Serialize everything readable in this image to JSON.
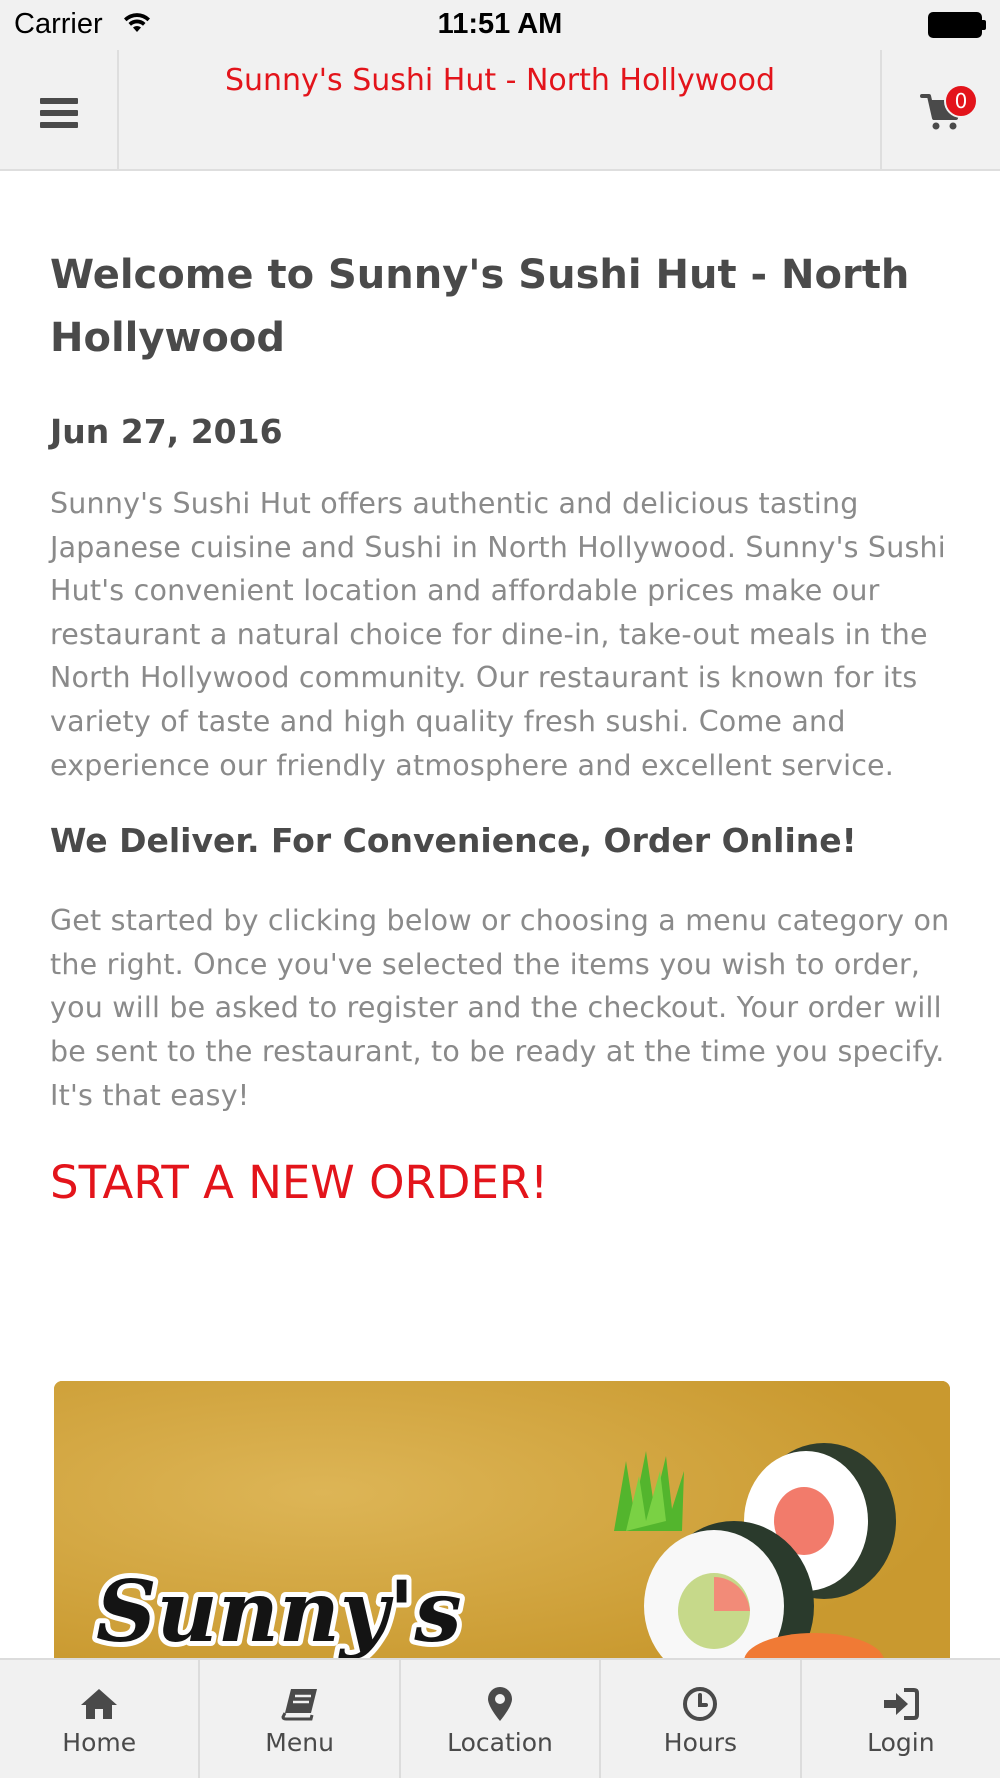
{
  "status_bar": {
    "carrier": "Carrier",
    "time": "11:51 AM"
  },
  "header": {
    "title": "Sunny's Sushi Hut - North Hollywood",
    "cart_count": "0",
    "accent_color": "#e3141b"
  },
  "main": {
    "welcome_heading": "Welcome to Sunny's Sushi Hut - North Hollywood",
    "date": "Jun 27, 2016",
    "intro": "Sunny's Sushi Hut offers authentic and delicious tasting Japanese cuisine and Sushi in North Hollywood. Sunny's Sushi Hut's convenient location and affordable prices make our restaurant a natural choice for dine-in, take-out meals in the North Hollywood community. Our restaurant is known for its variety of taste and high quality fresh sushi. Come and experience our friendly atmosphere and excellent service.",
    "deliver_heading": "We Deliver. For Convenience, Order Online!",
    "instructions": "Get started by clicking below or choosing a menu category on the right. Once you've selected the items you wish to order, you will be asked to register and the checkout. Your order will be sent to the restaurant, to be ready at the time you specify. It's that easy!",
    "start_order": "START A NEW ORDER!",
    "banner_logo_text": "Sunny's"
  },
  "tabbar": {
    "items": [
      {
        "label": "Home",
        "icon": "home-icon"
      },
      {
        "label": "Menu",
        "icon": "book-icon"
      },
      {
        "label": "Location",
        "icon": "map-marker-icon"
      },
      {
        "label": "Hours",
        "icon": "clock-icon"
      },
      {
        "label": "Login",
        "icon": "sign-in-icon"
      }
    ]
  }
}
